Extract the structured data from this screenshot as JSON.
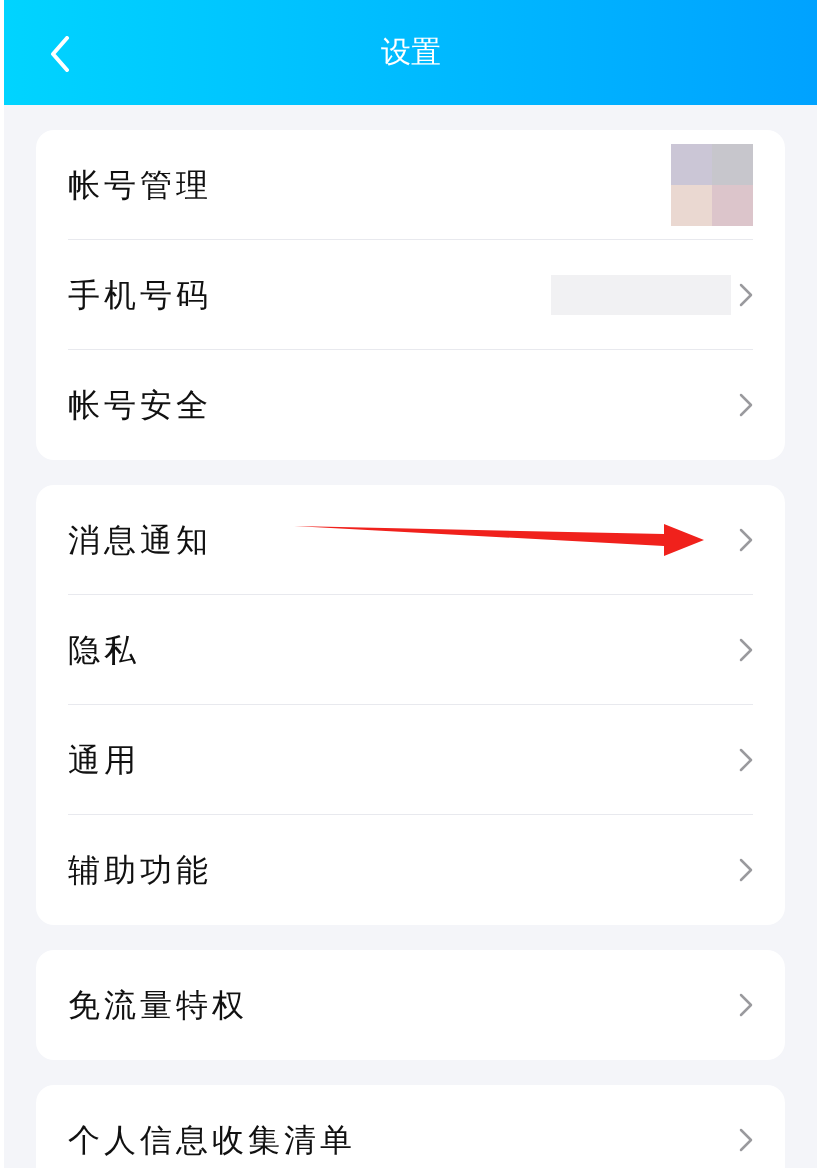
{
  "header": {
    "title": "设置"
  },
  "groups": [
    {
      "rows": [
        {
          "label": "帐号管理",
          "kind": "avatar",
          "marked": false
        },
        {
          "label": "手机号码",
          "kind": "phone",
          "marked": false
        },
        {
          "label": "帐号安全",
          "kind": "plain",
          "marked": false
        }
      ]
    },
    {
      "rows": [
        {
          "label": "消息通知",
          "kind": "plain",
          "marked": true
        },
        {
          "label": "隐私",
          "kind": "plain",
          "marked": false
        },
        {
          "label": "通用",
          "kind": "plain",
          "marked": false
        },
        {
          "label": "辅助功能",
          "kind": "plain",
          "marked": false
        }
      ]
    },
    {
      "rows": [
        {
          "label": "免流量特权",
          "kind": "plain",
          "marked": false
        }
      ]
    },
    {
      "rows": [
        {
          "label": "个人信息收集清单",
          "kind": "plain",
          "marked": false
        }
      ]
    }
  ]
}
